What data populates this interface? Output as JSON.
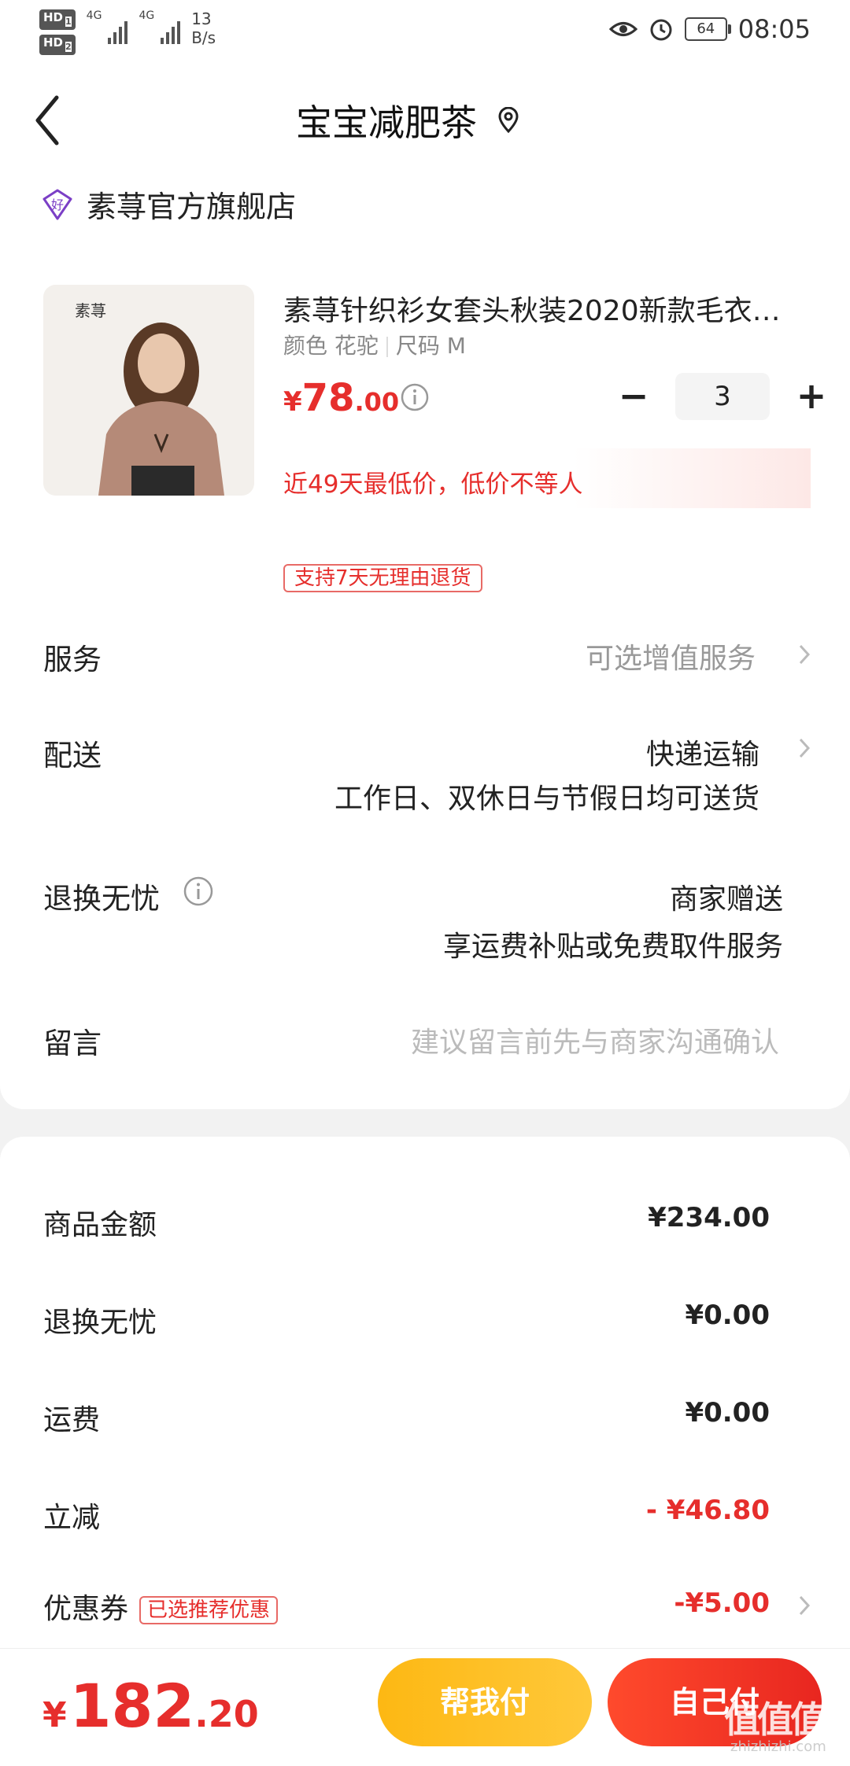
{
  "status_bar": {
    "sim1": "HD",
    "sim1_slot": "1",
    "sim2": "HD",
    "sim2_slot": "2",
    "net1": "4G",
    "net2": "4G",
    "speed_value": "13",
    "speed_unit": "B/s",
    "battery": "64",
    "time": "08:05"
  },
  "header": {
    "title": "宝宝减肥茶"
  },
  "shop": {
    "badge": "好",
    "name": "素荨官方旗舰店"
  },
  "product": {
    "image_text": "素荨",
    "title": "素荨针织衫女套头秋装2020新款毛衣…",
    "color_label": "颜色 花驼",
    "size_label": "尺码 M",
    "price_currency": "¥",
    "price_int": "78",
    "price_dec": ".00",
    "quantity": "3",
    "minus": "−",
    "plus": "+",
    "low_price_note": "近49天最低价，低价不等人",
    "return_tag": "支持7天无理由退货"
  },
  "options": {
    "service_label": "服务",
    "service_value": "可选增值服务",
    "delivery_label": "配送",
    "delivery_value": "快递运输",
    "delivery_note": "工作日、双休日与节假日均可送货",
    "worry_label": "退换无忧",
    "worry_value": "商家赠送",
    "worry_note": "享运费补贴或免费取件服务",
    "message_label": "留言",
    "message_placeholder": "建议留言前先与商家沟通确认"
  },
  "payment": {
    "goods_label": "商品金额",
    "goods_value": "¥234.00",
    "worry_label": "退换无忧",
    "worry_value": "¥0.00",
    "shipping_label": "运费",
    "shipping_value": "¥0.00",
    "discount_label": "立减",
    "discount_value": "- ¥46.80",
    "coupon_label": "优惠券",
    "coupon_badge": "已选推荐优惠",
    "coupon_value": "-¥5.00"
  },
  "footer": {
    "total_currency": "¥",
    "total_int": "182",
    "total_dec": ".20",
    "help_pay": "帮我付",
    "self_pay": "自己付",
    "watermark": "值值值",
    "watermark_url": "zhizhizhi.com"
  },
  "colors": {
    "accent_red": "#e62e2c",
    "accent_yellow": "#fdb813"
  }
}
